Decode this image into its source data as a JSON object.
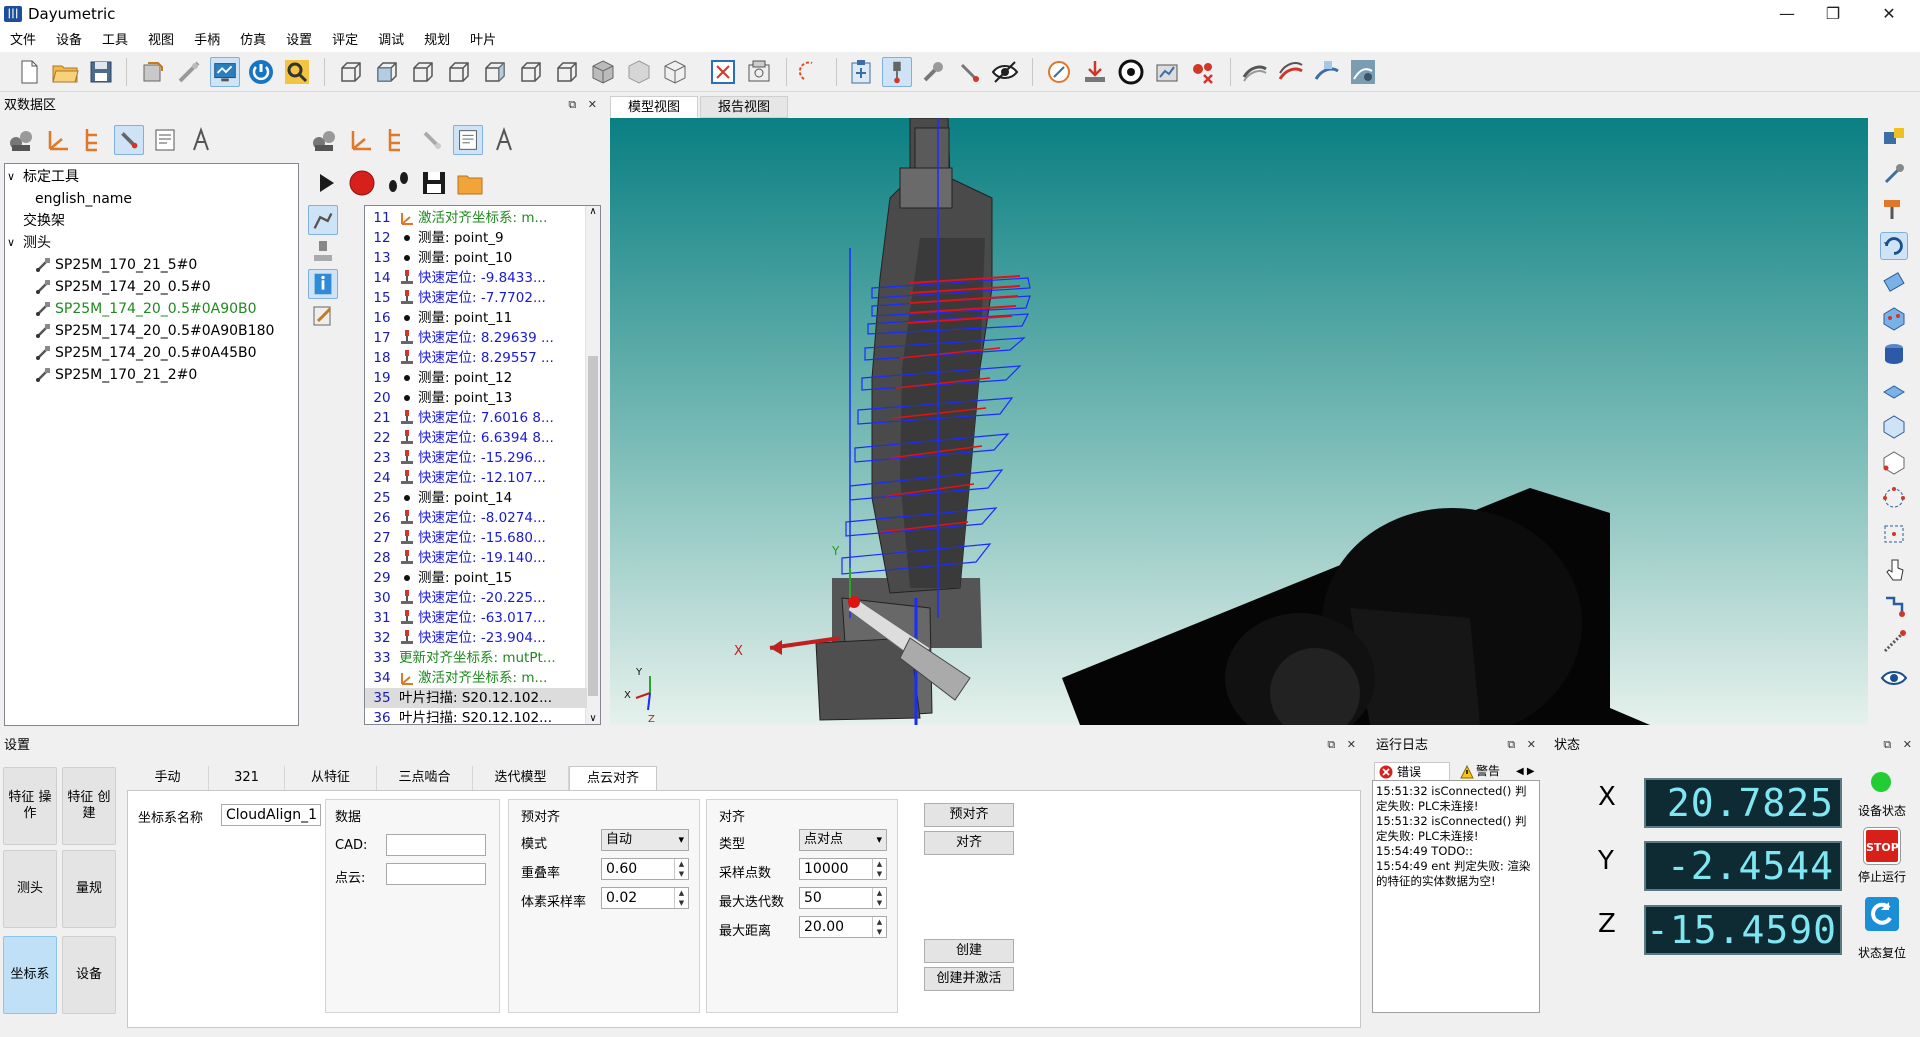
{
  "window": {
    "title": "Dayumetric",
    "minimize": "—",
    "maximize": "❐",
    "close": "✕"
  },
  "menu": [
    "文件",
    "设备",
    "工具",
    "视图",
    "手柄",
    "仿真",
    "设置",
    "评定",
    "调试",
    "规划",
    "叶片"
  ],
  "dataPanel": {
    "title": "双数据区"
  },
  "tree": [
    {
      "label": "标定工具",
      "level": 0,
      "expand": "∨"
    },
    {
      "label": "english_name",
      "level": 1
    },
    {
      "label": "交换架",
      "level": 0
    },
    {
      "label": "测头",
      "level": 0,
      "expand": "∨"
    },
    {
      "label": "SP25M_170_21_5#0",
      "level": 1,
      "icon": true
    },
    {
      "label": "SP25M_174_20_0.5#0",
      "level": 1,
      "icon": true
    },
    {
      "label": "SP25M_174_20_0.5#0A90B0",
      "level": 1,
      "icon": true,
      "color": "#1f8a1f"
    },
    {
      "label": "SP25M_174_20_0.5#0A90B180",
      "level": 1,
      "icon": true
    },
    {
      "label": "SP25M_174_20_0.5#0A45B0",
      "level": 1,
      "icon": true
    },
    {
      "label": "SP25M_170_21_2#0",
      "level": 1,
      "icon": true
    }
  ],
  "program": [
    {
      "n": "11",
      "icon": "axis",
      "text": "激活对齐坐标系: m...",
      "color": "#1f8a1f"
    },
    {
      "n": "12",
      "icon": "dot",
      "text": "测量: point_9",
      "color": "#000"
    },
    {
      "n": "13",
      "icon": "dot",
      "text": "测量: point_10",
      "color": "#000"
    },
    {
      "n": "14",
      "icon": "probe",
      "text": "快速定位: -9.8433...",
      "color": "#1a1ad6"
    },
    {
      "n": "15",
      "icon": "probe",
      "text": "快速定位: -7.7702...",
      "color": "#1a1ad6"
    },
    {
      "n": "16",
      "icon": "dot",
      "text": "测量: point_11",
      "color": "#000"
    },
    {
      "n": "17",
      "icon": "probe",
      "text": "快速定位: 8.29639 ...",
      "color": "#1a1ad6"
    },
    {
      "n": "18",
      "icon": "probe",
      "text": "快速定位: 8.29557 ...",
      "color": "#1a1ad6"
    },
    {
      "n": "19",
      "icon": "dot",
      "text": "测量: point_12",
      "color": "#000"
    },
    {
      "n": "20",
      "icon": "dot",
      "text": "测量: point_13",
      "color": "#000"
    },
    {
      "n": "21",
      "icon": "probe",
      "text": "快速定位: 7.6016 8...",
      "color": "#1a1ad6"
    },
    {
      "n": "22",
      "icon": "probe",
      "text": "快速定位: 6.6394 8...",
      "color": "#1a1ad6"
    },
    {
      "n": "23",
      "icon": "probe",
      "text": "快速定位: -15.296...",
      "color": "#1a1ad6"
    },
    {
      "n": "24",
      "icon": "probe",
      "text": "快速定位: -12.107...",
      "color": "#1a1ad6"
    },
    {
      "n": "25",
      "icon": "dot",
      "text": "测量: point_14",
      "color": "#000"
    },
    {
      "n": "26",
      "icon": "probe",
      "text": "快速定位: -8.0274...",
      "color": "#1a1ad6"
    },
    {
      "n": "27",
      "icon": "probe",
      "text": "快速定位: -15.680...",
      "color": "#1a1ad6"
    },
    {
      "n": "28",
      "icon": "probe",
      "text": "快速定位: -19.140...",
      "color": "#1a1ad6"
    },
    {
      "n": "29",
      "icon": "dot",
      "text": "测量: point_15",
      "color": "#000"
    },
    {
      "n": "30",
      "icon": "probe",
      "text": "快速定位: -20.225...",
      "color": "#1a1ad6"
    },
    {
      "n": "31",
      "icon": "probe",
      "text": "快速定位: -63.017...",
      "color": "#1a1ad6"
    },
    {
      "n": "32",
      "icon": "probe",
      "text": "快速定位: -23.904...",
      "color": "#1a1ad6"
    },
    {
      "n": "33",
      "icon": "none",
      "text": "更新对齐坐标系: mutPt...",
      "color": "#1f8a1f"
    },
    {
      "n": "34",
      "icon": "axis",
      "text": "激活对齐坐标系: m...",
      "color": "#1f8a1f"
    },
    {
      "n": "35",
      "icon": "none",
      "text": "叶片扫描: S20.12.102...",
      "color": "#000",
      "selected": true
    },
    {
      "n": "36",
      "icon": "none",
      "text": "叶片扫描: S20.12.102...",
      "color": "#000"
    }
  ],
  "viewTabs": [
    "模型视图",
    "报告视图"
  ],
  "axisLabels": {
    "x": "X",
    "y": "Y",
    "z": "Z",
    "x2": "X",
    "y2": "Y"
  },
  "settings": {
    "title": "设置",
    "sideButtons": [
      "特征\n操作",
      "特征\n创建",
      "测头",
      "量规",
      "坐标系",
      "设备"
    ],
    "tabs": [
      "手动",
      "321",
      "从特征",
      "三点啮合",
      "迭代模型",
      "点云对齐"
    ],
    "csNameLabel": "坐标系名称",
    "csNameValue": "CloudAlign_1",
    "dataGroup": {
      "title": "数据",
      "cad": "CAD:",
      "cloud": "点云:"
    },
    "prealign": {
      "title": "预对齐",
      "modeLabel": "模式",
      "modeValue": "自动",
      "overlapLabel": "重叠率",
      "overlapValue": "0.60",
      "voxelLabel": "体素采样率",
      "voxelValue": "0.02"
    },
    "align": {
      "title": "对齐",
      "typeLabel": "类型",
      "typeValue": "点对点",
      "samplesLabel": "采样点数",
      "samplesValue": "10000",
      "iterLabel": "最大迭代数",
      "iterValue": "50",
      "distLabel": "最大距离",
      "distValue": "20.00"
    },
    "buttons": {
      "prealign": "预对齐",
      "align": "对齐",
      "create": "创建",
      "createActivate": "创建并激活"
    }
  },
  "log": {
    "title": "运行日志",
    "tabError": "错误",
    "tabWarn": "警告",
    "lines": "15:51:32 isConnected() 判定失败: PLC未连接!\n15:51:32 isConnected() 判定失败: PLC未连接!\n15:54:49 TODO::\n15:54:49 ent 判定失败: 渲染的特征的实体数据为空!"
  },
  "status": {
    "title": "状态",
    "x": {
      "label": "X",
      "value": "20.7825"
    },
    "y": {
      "label": "Y",
      "value": "-2.4544"
    },
    "z": {
      "label": "Z",
      "value": "-15.4590"
    },
    "deviceState": "设备状态",
    "stopRun": "停止运行",
    "resetState": "状态复位",
    "stopBadge": "STOP",
    "stateColor": "#22cc33"
  }
}
